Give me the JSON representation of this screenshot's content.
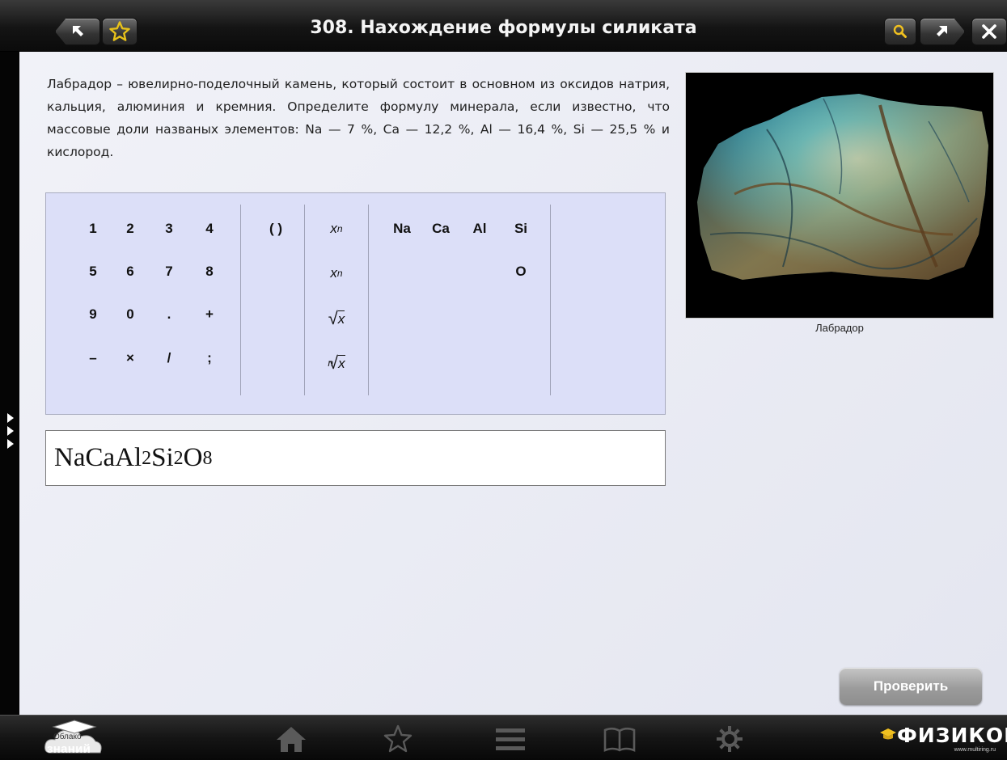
{
  "header": {
    "title": "308. Нахождение формулы силиката"
  },
  "problem": {
    "text": "Лабрадор – ювелирно-поделочный камень, который состоит в основном из оксидов натрия, кальция, алюминия и кремния. Определите формулу минерала, если известно, что массовые доли названых элементов: Na — 7 %, Ca — 12,2 %, Al — 16,4 %, Si — 25,5 % и кислород."
  },
  "keypad": {
    "digits": [
      "1",
      "2",
      "3",
      "4",
      "5",
      "6",
      "7",
      "8",
      "9",
      "0",
      ".",
      "+",
      "–",
      "×",
      "/",
      ";"
    ],
    "parentheses": "( )",
    "math": {
      "subscript_base": "x",
      "subscript_exp": "n",
      "power_base": "x",
      "power_exp": "n",
      "sqrt_symbol": "√",
      "sqrt_arg": "x",
      "nroot_index": "n",
      "nroot_symbol": "√",
      "nroot_arg": "x"
    },
    "elements_row1": [
      "Na",
      "Ca",
      "Al",
      "Si"
    ],
    "elements_row2": [
      "O"
    ]
  },
  "answer": {
    "parts": [
      "NaCaAl",
      "2",
      "Si",
      "2",
      "O",
      "8"
    ]
  },
  "image": {
    "caption": "Лабрадор"
  },
  "actions": {
    "check_label": "Проверить"
  },
  "footer": {
    "cloud_small": "Облако",
    "cloud_big": "знаний",
    "brand_name": "ФИЗИКОН",
    "brand_url": "www.multiring.ru"
  },
  "colors": {
    "keypad_bg": "#dcdff8",
    "star_accent": "#e8c21a",
    "search_accent": "#f0c020"
  }
}
